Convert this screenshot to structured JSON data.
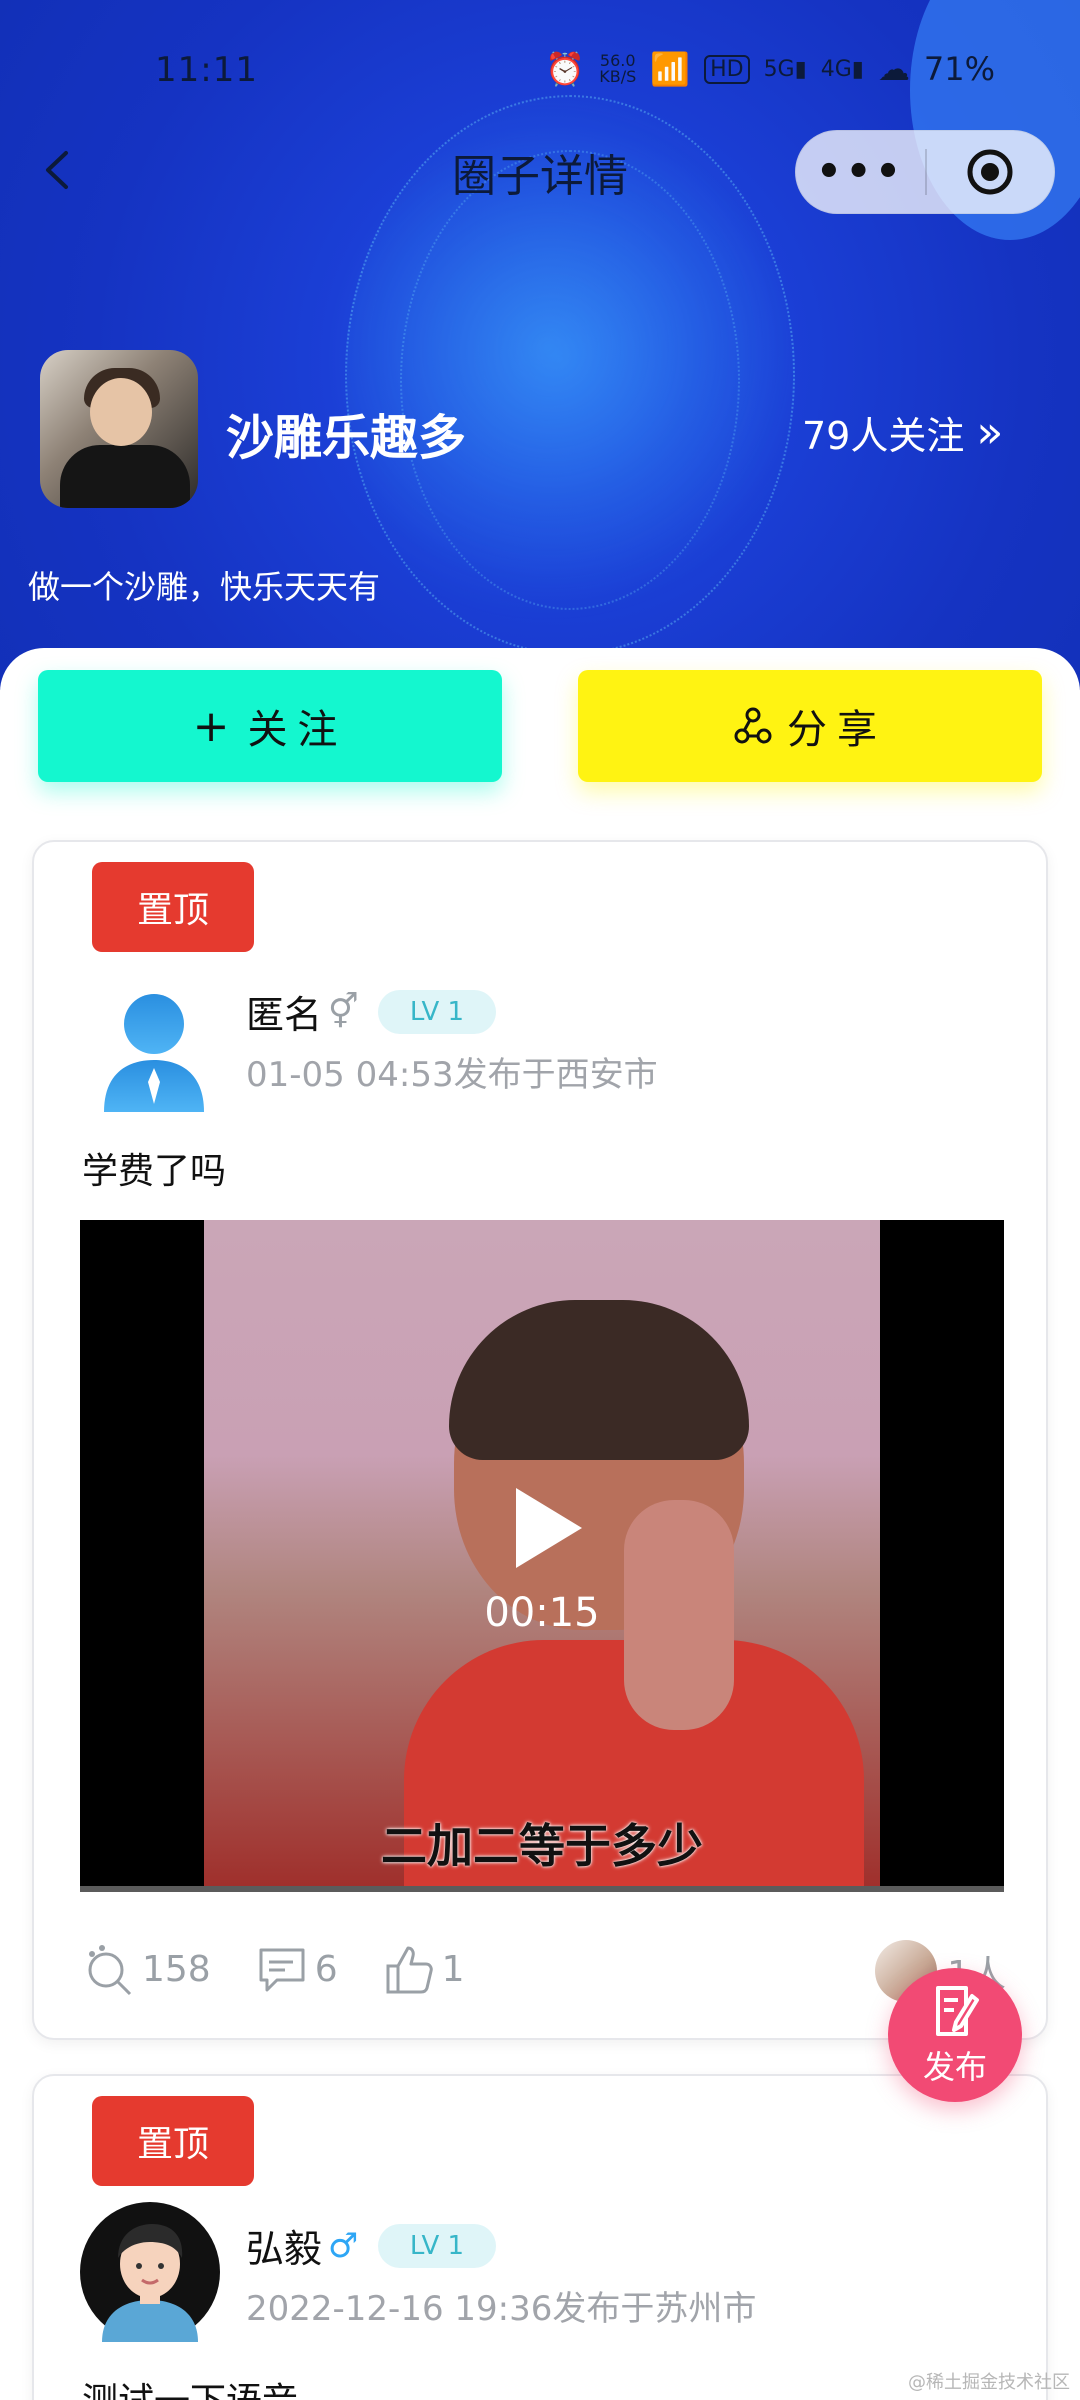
{
  "status_bar": {
    "time": "11:11",
    "net_speed_top": "56.0",
    "net_speed_bottom": "KB/S",
    "hd": "HD",
    "sig1": "5G",
    "sig2": "4G",
    "battery": "71%"
  },
  "nav": {
    "title": "圈子详情",
    "more_label": "•••"
  },
  "circle": {
    "name": "沙雕乐趣多",
    "followers": "79人关注",
    "followers_arrow": "»",
    "description": "做一个沙雕，快乐天天有"
  },
  "actions": {
    "follow_label": "关注",
    "share_label": "分享"
  },
  "posts": [
    {
      "pin_label": "置顶",
      "author": "匿名",
      "gender_symbol": "⚥",
      "level": "LV 1",
      "meta": "01-05 04:53发布于西安市",
      "text": "学费了吗",
      "video": {
        "duration": "00:15",
        "subtitle": "二加二等于多少"
      },
      "views": "158",
      "comments": "6",
      "likes": "1",
      "viewers": "1人"
    },
    {
      "pin_label": "置顶",
      "author": "弘毅",
      "gender_symbol": "♂",
      "level": "LV 1",
      "meta": "2022-12-16 19:36发布于苏州市",
      "text": "测试一下语音"
    }
  ],
  "fab": {
    "label": "发布"
  },
  "watermark": "@稀土掘金技术社区",
  "colors": {
    "follow_button": "#14f7cf",
    "share_button": "#fff312",
    "pin_badge": "#e53a2f",
    "fab": "#f24a74",
    "hero_blue": "#1b3fd6"
  }
}
